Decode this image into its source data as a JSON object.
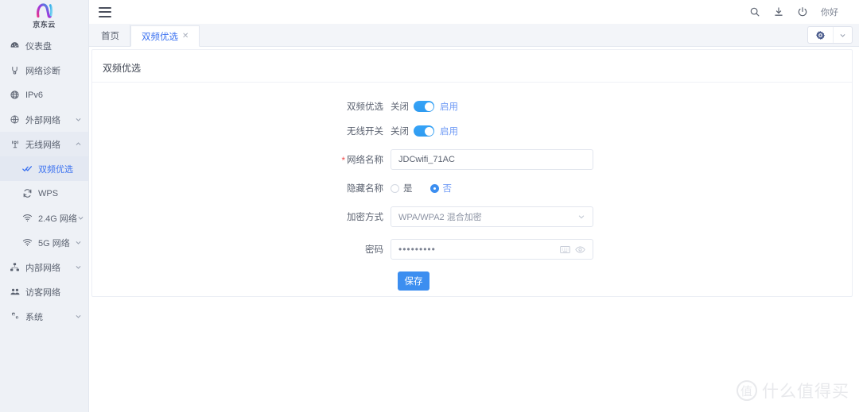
{
  "brand": {
    "name": "京东云",
    "logo_icon": "jd-cloud-n-logo"
  },
  "sidebar": {
    "items": [
      {
        "label": "仪表盘",
        "icon": "dashboard-icon",
        "expandable": false,
        "active": false,
        "sub": false
      },
      {
        "label": "网络诊断",
        "icon": "network-diagnose-icon",
        "expandable": false,
        "active": false,
        "sub": false
      },
      {
        "label": "IPv6",
        "icon": "globe-icon",
        "expandable": false,
        "active": false,
        "sub": false
      },
      {
        "label": "外部网络",
        "icon": "external-network-icon",
        "expandable": true,
        "active": false,
        "sub": false,
        "caret": "chevron-down-icon"
      },
      {
        "label": "无线网络",
        "icon": "wireless-icon",
        "expandable": true,
        "active": false,
        "sub": false,
        "caret": "chevron-up-icon",
        "expanded": true
      },
      {
        "label": "双频优选",
        "icon": "check-double-icon",
        "expandable": false,
        "active": true,
        "sub": true
      },
      {
        "label": "WPS",
        "icon": "refresh-icon",
        "expandable": false,
        "active": false,
        "sub": true
      },
      {
        "label": "2.4G 网络",
        "icon": "wifi-icon",
        "expandable": true,
        "active": false,
        "sub": true,
        "caret": "chevron-down-icon"
      },
      {
        "label": "5G 网络",
        "icon": "wifi-icon",
        "expandable": true,
        "active": false,
        "sub": true,
        "caret": "chevron-down-icon"
      },
      {
        "label": "内部网络",
        "icon": "sitemap-icon",
        "expandable": true,
        "active": false,
        "sub": false,
        "caret": "chevron-down-icon"
      },
      {
        "label": "访客网络",
        "icon": "users-icon",
        "expandable": false,
        "active": false,
        "sub": false
      },
      {
        "label": "系统",
        "icon": "cogs-icon",
        "expandable": true,
        "active": false,
        "sub": false,
        "caret": "chevron-down-icon"
      }
    ]
  },
  "topbar": {
    "menu_icon": "hamburger-menu-icon",
    "search_icon": "search-icon",
    "download_icon": "download-icon",
    "power_icon": "power-icon",
    "greeting": "你好"
  },
  "tabs": [
    {
      "label": "首页",
      "active": false,
      "closable": false
    },
    {
      "label": "双频优选",
      "active": true,
      "closable": true,
      "close_icon": "close-icon"
    }
  ],
  "tab_actions": {
    "gear_icon": "gear-icon",
    "caret_icon": "chevron-down-icon"
  },
  "panel": {
    "title": "双频优选"
  },
  "form": {
    "band_steering": {
      "label": "双频优选",
      "off_label": "关闭",
      "on_label": "启用",
      "value": "on"
    },
    "wireless_switch": {
      "label": "无线开关",
      "off_label": "关闭",
      "on_label": "启用",
      "value": "on"
    },
    "ssid": {
      "label": "网络名称",
      "required": true,
      "required_mark": "*",
      "value": "JDCwifi_71AC",
      "placeholder": ""
    },
    "hide_ssid": {
      "label": "隐藏名称",
      "options": [
        {
          "label": "是",
          "selected": false
        },
        {
          "label": "否",
          "selected": true
        }
      ]
    },
    "encryption": {
      "label": "加密方式",
      "value": "WPA/WPA2 混合加密",
      "caret_icon": "chevron-down-icon",
      "options": [
        "WPA/WPA2 混合加密"
      ]
    },
    "password": {
      "label": "密码",
      "value": "•••••••••",
      "keyboard_icon": "keyboard-icon",
      "eye_icon": "eye-icon"
    },
    "save_button": {
      "label": "保存"
    }
  },
  "watermark": {
    "mark": "值",
    "text": "什么值得买"
  },
  "colors": {
    "accent": "#3c8ef0",
    "link": "#6f9af5",
    "sidebar_bg": "#eef1f6",
    "tabbar_bg": "#f3f5f9",
    "text": "#5b6270",
    "required": "#f04b4b"
  }
}
